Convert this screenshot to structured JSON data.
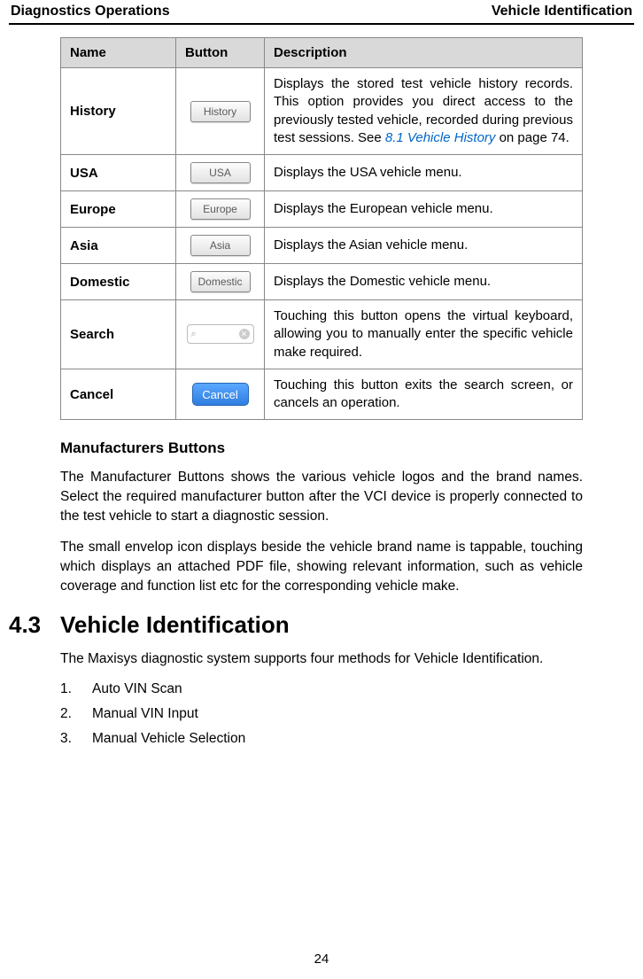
{
  "header": {
    "left": "Diagnostics Operations",
    "right": "Vehicle Identification"
  },
  "table": {
    "headers": {
      "name": "Name",
      "button": "Button",
      "desc": "Description"
    },
    "rows": [
      {
        "name": "History",
        "button_label": "History",
        "button_type": "std",
        "desc_pre": "Displays the stored test vehicle history records. This option provides you direct access to the previously tested vehicle, recorded during previous test sessions. See ",
        "desc_link": "8.1 Vehicle History",
        "desc_post": " on page 74."
      },
      {
        "name": "USA",
        "button_label": "USA",
        "button_type": "std",
        "desc_pre": "Displays the USA vehicle menu.",
        "desc_link": "",
        "desc_post": ""
      },
      {
        "name": "Europe",
        "button_label": "Europe",
        "button_type": "std",
        "desc_pre": "Displays the European vehicle menu.",
        "desc_link": "",
        "desc_post": ""
      },
      {
        "name": "Asia",
        "button_label": "Asia",
        "button_type": "std",
        "desc_pre": "Displays the Asian vehicle menu.",
        "desc_link": "",
        "desc_post": ""
      },
      {
        "name": "Domestic",
        "button_label": "Domestic",
        "button_type": "std",
        "desc_pre": "Displays the Domestic vehicle menu.",
        "desc_link": "",
        "desc_post": ""
      },
      {
        "name": "Search",
        "button_label": "",
        "button_type": "search",
        "desc_pre": "Touching this button opens the virtual keyboard, allowing you to manually enter the specific vehicle make required.",
        "desc_link": "",
        "desc_post": ""
      },
      {
        "name": "Cancel",
        "button_label": "Cancel",
        "button_type": "cancel",
        "desc_pre": "Touching this button exits the search screen, or cancels an operation.",
        "desc_link": "",
        "desc_post": ""
      }
    ]
  },
  "subheading": "Manufacturers Buttons",
  "para1": "The Manufacturer Buttons shows the various vehicle logos and the brand names. Select the required manufacturer button after the VCI device is properly connected to the test vehicle to start a diagnostic session.",
  "para2": "The small envelop icon displays beside the vehicle brand name is tappable, touching which displays an attached PDF file, showing relevant information, such as vehicle coverage and function list etc for the corresponding vehicle make.",
  "section": {
    "num": "4.3",
    "title": "Vehicle Identification"
  },
  "para3": "The Maxisys diagnostic system supports four methods for Vehicle Identification.",
  "list": [
    {
      "num": "1.",
      "text": "Auto VIN Scan"
    },
    {
      "num": "2.",
      "text": "Manual VIN Input"
    },
    {
      "num": "3.",
      "text": "Manual Vehicle Selection"
    }
  ],
  "page_number": "24",
  "glyphs": {
    "mag": "⌕",
    "x": "✕"
  }
}
